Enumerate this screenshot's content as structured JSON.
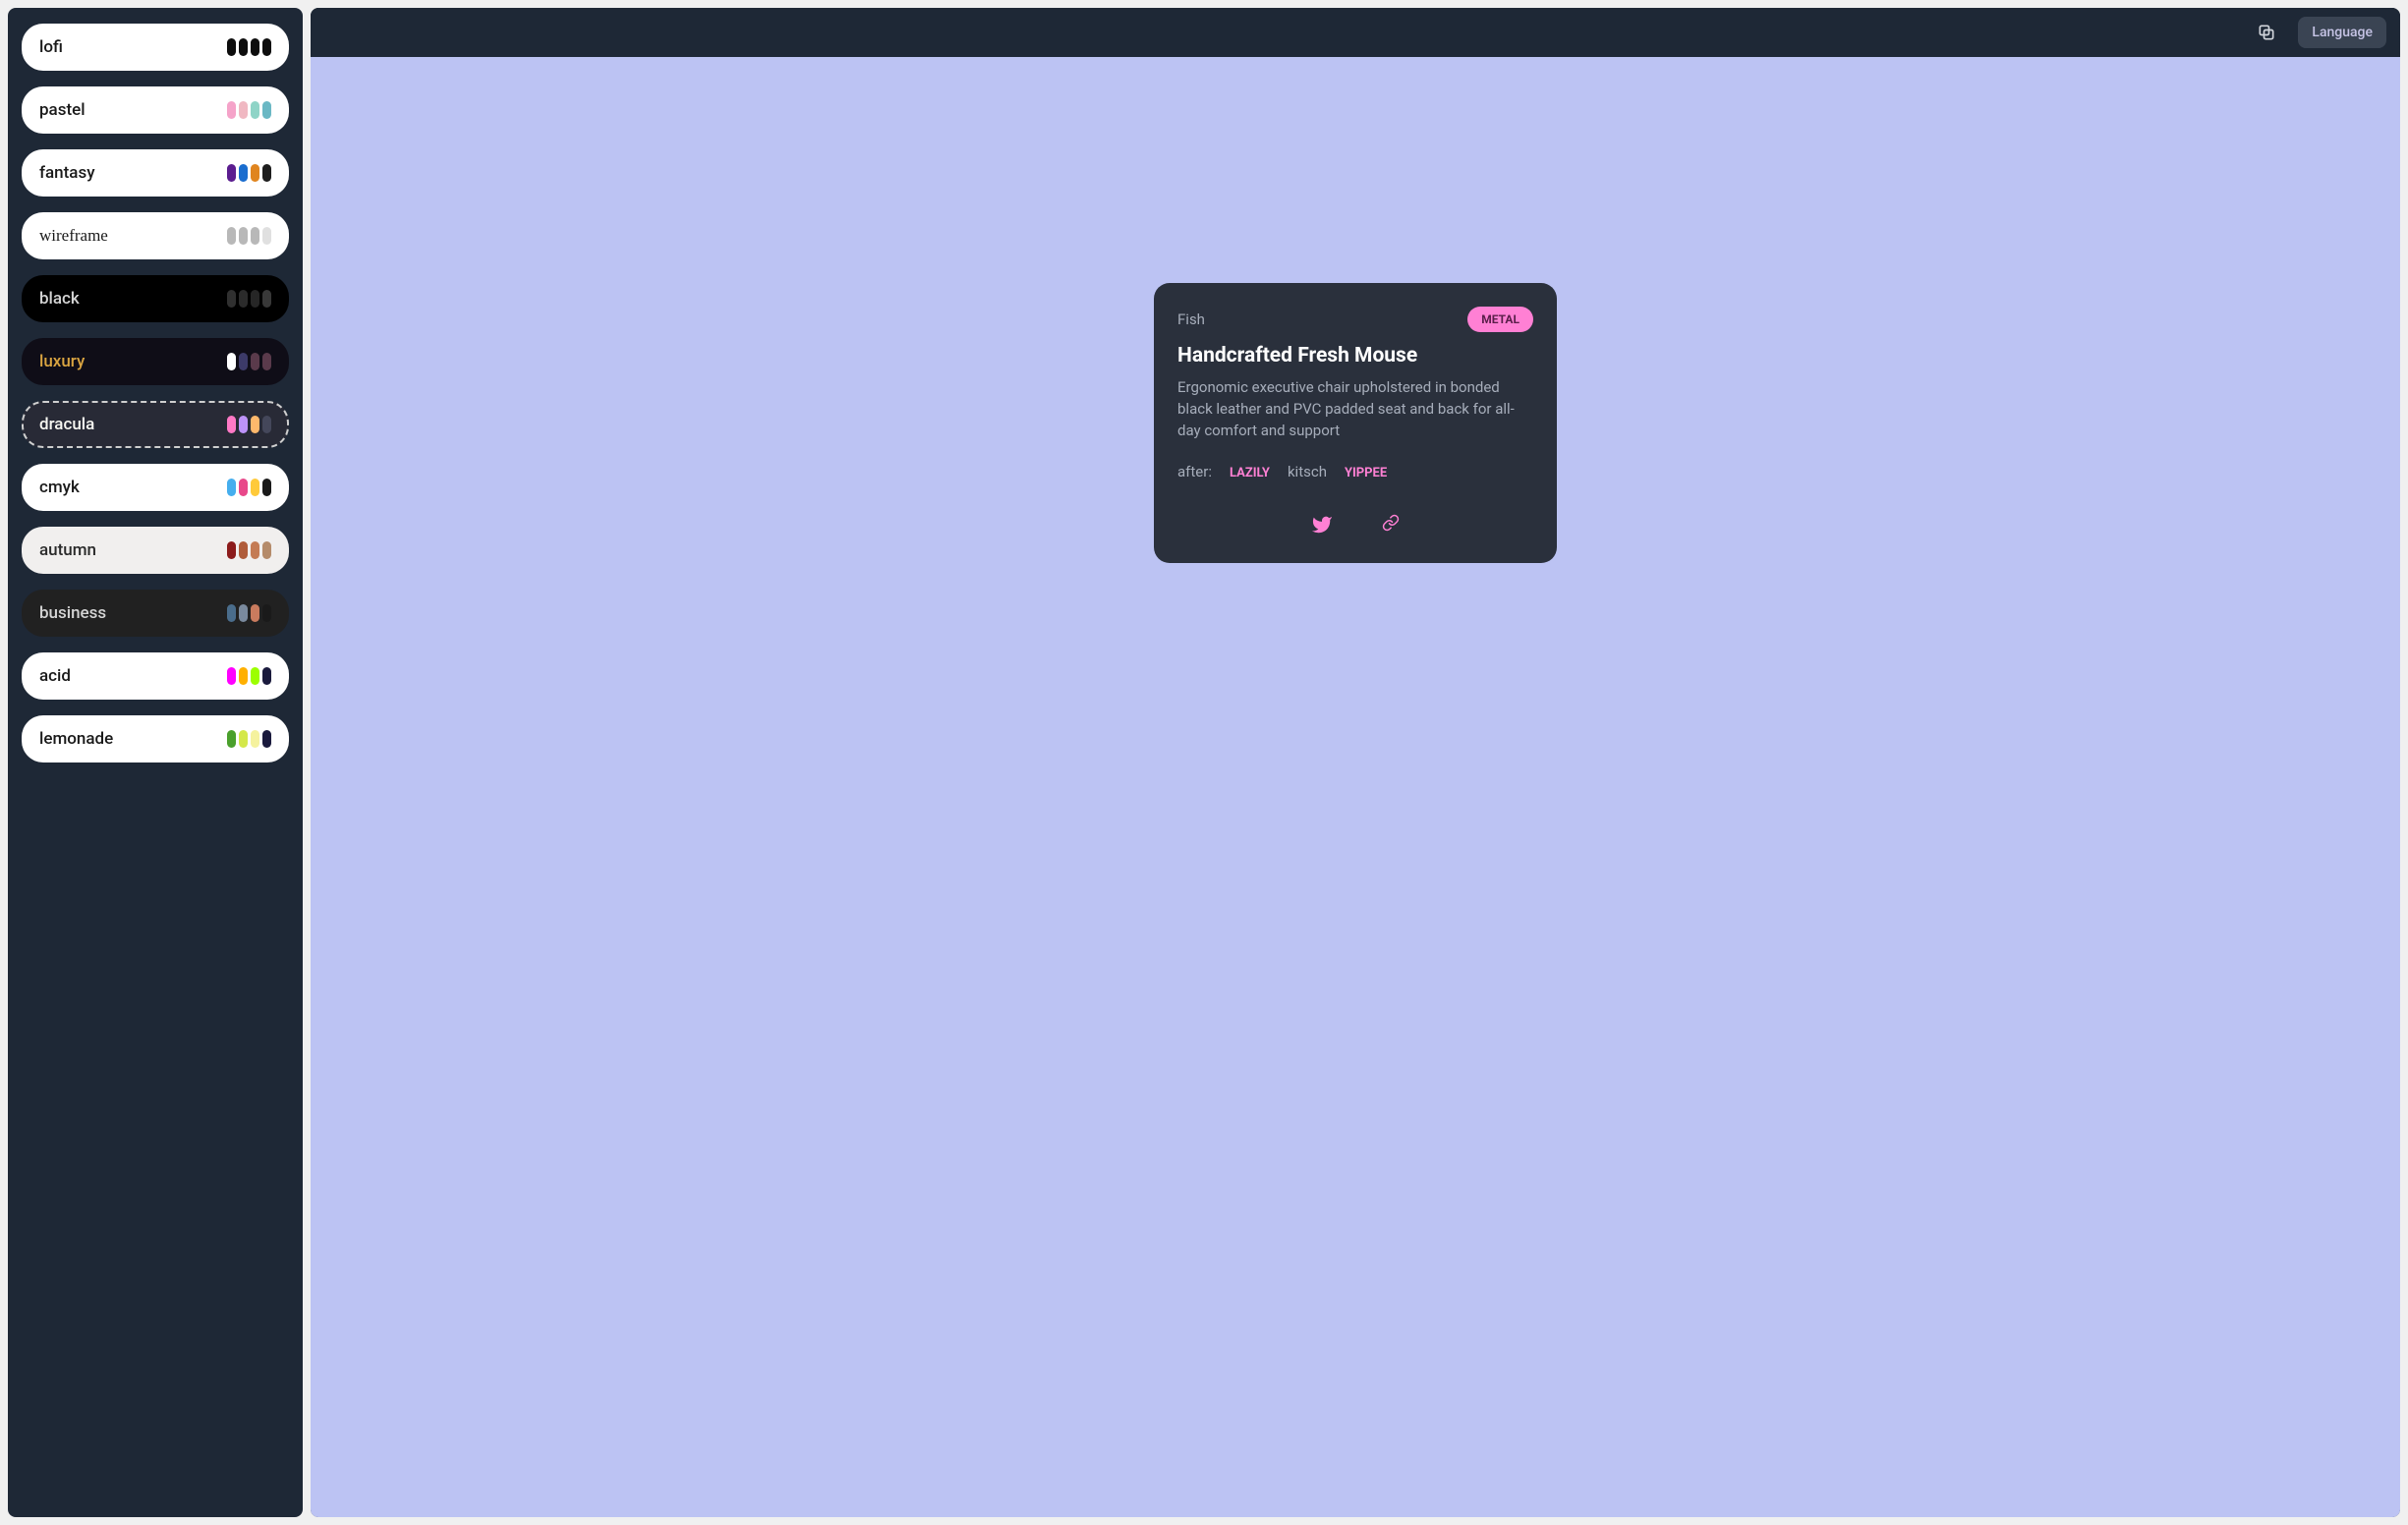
{
  "topbar": {
    "language_label": "Language"
  },
  "sidebar": {
    "themes": [
      {
        "name": "lofi",
        "bg": "#ffffff",
        "fg": "#1a1a1a",
        "swatches": [
          "#0d0d0d",
          "#0d0d0d",
          "#0d0d0d",
          "#0d0d0d"
        ],
        "font": ""
      },
      {
        "name": "pastel",
        "bg": "#ffffff",
        "fg": "#1a1a1a",
        "swatches": [
          "#f5a3c9",
          "#f0b8c2",
          "#8fd4c7",
          "#6bb8c4"
        ],
        "font": ""
      },
      {
        "name": "fantasy",
        "bg": "#ffffff",
        "fg": "#1a1a1a",
        "swatches": [
          "#5b1d8f",
          "#1a6dcf",
          "#e0851f",
          "#1e1e1e"
        ],
        "font": ""
      },
      {
        "name": "wireframe",
        "bg": "#ffffff",
        "fg": "#1a1a1a",
        "swatches": [
          "#b8b8b8",
          "#b8b8b8",
          "#b8b8b8",
          "#e0e0e0"
        ],
        "font": "wireframe-font"
      },
      {
        "name": "black",
        "bg": "#000000",
        "fg": "#d4d4d4",
        "swatches": [
          "#303030",
          "#2b2b2b",
          "#262626",
          "#383838"
        ],
        "font": ""
      },
      {
        "name": "luxury",
        "bg": "#0f0d17",
        "fg": "#d9a441",
        "swatches": [
          "#ffffff",
          "#3c3a68",
          "#5a3a4b",
          "#5a3a4b"
        ],
        "font": ""
      },
      {
        "name": "dracula",
        "bg": "#282a36",
        "fg": "#f8f8f2",
        "swatches": [
          "#ff79c6",
          "#bd93f9",
          "#ffb86c",
          "#44475a"
        ],
        "font": "",
        "selected": true
      },
      {
        "name": "cmyk",
        "bg": "#ffffff",
        "fg": "#1a1a1a",
        "swatches": [
          "#45aeee",
          "#e8488a",
          "#ffca3a",
          "#1a1a1a"
        ],
        "font": ""
      },
      {
        "name": "autumn",
        "bg": "#f1efee",
        "fg": "#2b2b2b",
        "swatches": [
          "#8c1b1b",
          "#b05c3a",
          "#c47b54",
          "#b58b6a"
        ],
        "font": ""
      },
      {
        "name": "business",
        "bg": "#212121",
        "fg": "#d4d4d4",
        "swatches": [
          "#4a6d8c",
          "#7a8a9e",
          "#c97b5e",
          "#1a1a1a"
        ],
        "font": ""
      },
      {
        "name": "acid",
        "bg": "#ffffff",
        "fg": "#1a1a1a",
        "swatches": [
          "#ff00ff",
          "#ffb000",
          "#9cff00",
          "#1a1a3d"
        ],
        "font": ""
      },
      {
        "name": "lemonade",
        "bg": "#ffffff",
        "fg": "#1a1a1a",
        "swatches": [
          "#4aa02c",
          "#d4e84a",
          "#f5f29e",
          "#1a1a3d"
        ],
        "font": ""
      }
    ]
  },
  "card": {
    "category": "Fish",
    "badge": "METAL",
    "title": "Handcrafted Fresh Mouse",
    "description": "Ergonomic executive chair upholstered in bonded black leather and PVC padded seat and back for all-day comfort and support",
    "tags_label": "after:",
    "tags": {
      "primary": "LAZILY",
      "secondary": "kitsch",
      "accent": "YIPPEE"
    }
  }
}
